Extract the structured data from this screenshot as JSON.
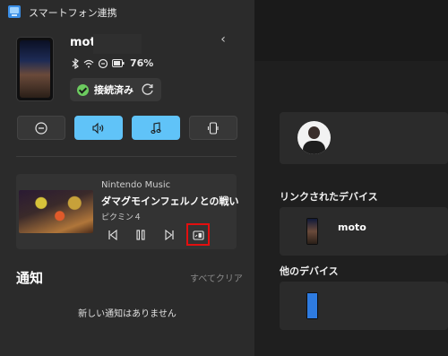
{
  "window": {
    "title": "スマートフォン連携"
  },
  "device": {
    "name": "moto",
    "battery": "76%",
    "status_label": "接続済み"
  },
  "quick_settings": [
    {
      "icon": "do-not-disturb-icon",
      "active": false
    },
    {
      "icon": "volume-icon",
      "active": true
    },
    {
      "icon": "music-note-icon",
      "active": true
    },
    {
      "icon": "phone-vibrate-icon",
      "active": false
    }
  ],
  "media": {
    "app": "Nintendo Music",
    "title": "ダマグモインフェルノとの戦い",
    "artist": "ピクミン４"
  },
  "notifications": {
    "title": "通知",
    "clear_all": "すべてクリア",
    "empty": "新しい通知はありません"
  },
  "main": {
    "linked_devices_label": "リンクされたデバイス",
    "linked_device_name": "moto",
    "other_devices_label": "他のデバイス"
  },
  "colors": {
    "accent": "#60c3f8",
    "connected": "#6ccb5f",
    "highlight": "#e30f0f"
  }
}
